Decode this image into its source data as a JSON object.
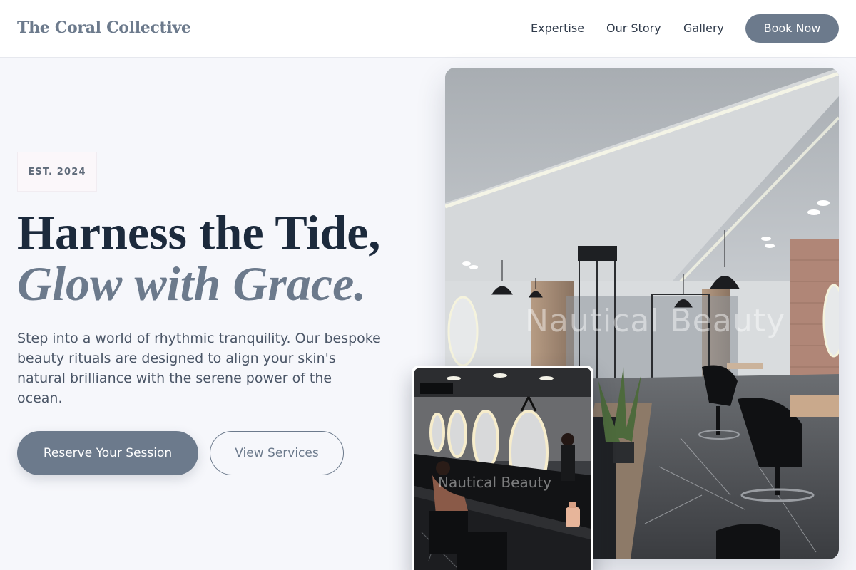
{
  "header": {
    "logo": "The Coral Collective",
    "nav": [
      {
        "label": "Expertise"
      },
      {
        "label": "Our Story"
      },
      {
        "label": "Gallery"
      }
    ],
    "cta_label": "Book Now"
  },
  "hero": {
    "badge": "EST. 2024",
    "headline_line1": "Harness the Tide,",
    "headline_line2": "Glow with Grace.",
    "lead": "Step into a world of rhythmic tranquility. Our bespoke beauty rituals are designed to align your skin's natural brilliance with the serene power of the ocean.",
    "primary_cta": "Reserve Your Session",
    "secondary_cta": "View Services"
  },
  "images": {
    "main_watermark": "Nautical Beauty",
    "inset_watermark": "Nautical Beauty"
  },
  "colors": {
    "accent": "#6c7a8c",
    "heading": "#1c2a3c",
    "background": "#f6f7fb"
  }
}
